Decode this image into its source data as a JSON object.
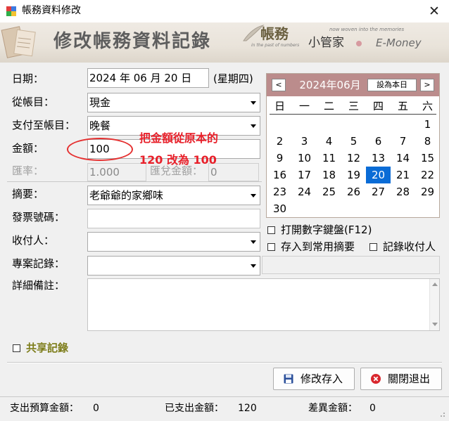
{
  "window": {
    "title": "帳務資料修改",
    "close_glyph": "✕"
  },
  "banner": {
    "title": "修改帳務資料記錄",
    "logo_main": "帳務",
    "logo_sub": "小管家",
    "logo_en": "E-Money",
    "logo_script1": "now woven into the memories",
    "logo_script2": "in the past of numbers"
  },
  "form": {
    "date": {
      "label": "日期：",
      "value": "2024 年 06 月 20 日",
      "weekday": "(星期四)"
    },
    "from_account": {
      "label": "從帳目：",
      "value": "現金"
    },
    "to_account": {
      "label": "支付至帳目：",
      "value": "晚餐"
    },
    "amount": {
      "label": "金額：",
      "value": "100"
    },
    "rate": {
      "label": "匯率：",
      "value": "1.000"
    },
    "exchange": {
      "label": "匯兌金額：",
      "value": "0"
    },
    "summary": {
      "label": "摘要：",
      "value": "老爺爺的家鄉味"
    },
    "invoice": {
      "label": "發票號碼：",
      "value": ""
    },
    "payee": {
      "label": "收付人：",
      "value": ""
    },
    "project": {
      "label": "專案記錄：",
      "value": ""
    },
    "notes": {
      "label": "詳細備註：",
      "value": ""
    },
    "shared": {
      "label": "共享記錄"
    }
  },
  "calendar": {
    "prev": "<",
    "next": ">",
    "title": "2024年06月",
    "today_button": "設為本日",
    "weekdays": [
      "日",
      "一",
      "二",
      "三",
      "四",
      "五",
      "六"
    ],
    "weeks": [
      [
        "",
        "",
        "",
        "",
        "",
        "",
        "1"
      ],
      [
        "2",
        "3",
        "4",
        "5",
        "6",
        "7",
        "8"
      ],
      [
        "9",
        "10",
        "11",
        "12",
        "13",
        "14",
        "15"
      ],
      [
        "16",
        "17",
        "18",
        "19",
        "20",
        "21",
        "22"
      ],
      [
        "23",
        "24",
        "25",
        "26",
        "27",
        "28",
        "29"
      ],
      [
        "30",
        "",
        "",
        "",
        "",
        "",
        ""
      ]
    ],
    "selected_day": "20"
  },
  "options": {
    "numpad": "打開數字鍵盤(F12)",
    "save_common": "存入到常用摘要",
    "record_payee": "記錄收付人"
  },
  "annotation": {
    "line1": "把金額從原本的",
    "line2": "120 改為 100"
  },
  "buttons": {
    "save": "修改存入",
    "close": "關閉退出"
  },
  "footer": {
    "budget_label": "支出預算金額：",
    "budget_value": "0",
    "spent_label": "已支出金額：",
    "spent_value": "120",
    "diff_label": "差異金額：",
    "diff_value": "0"
  },
  "colors": {
    "calendar_header": "#bb8c8c",
    "selected_day": "#0a6cd6",
    "annotation": "#e8202a",
    "shared_label": "#7d7d1a"
  }
}
